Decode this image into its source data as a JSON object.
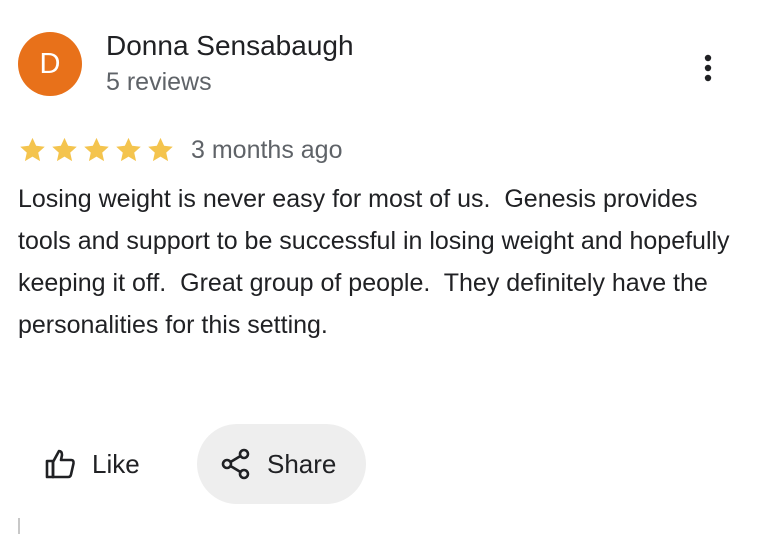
{
  "author": {
    "initial": "D",
    "name": "Donna Sensabaugh",
    "meta": "5 reviews",
    "avatar_color": "#e8711a"
  },
  "more_menu": {
    "icon": "more-vert-icon"
  },
  "review": {
    "rating": 5,
    "max_rating": 5,
    "star_color": "#f4c44e",
    "date": "3 months ago",
    "text": "Losing weight is never easy for most of us.  Genesis provides tools and support to be successful in losing weight and hopefully keeping it off.  Great group of people.  They definitely have the personalities for this setting."
  },
  "actions": {
    "like_label": "Like",
    "like_icon": "thumb-up-icon",
    "share_label": "Share",
    "share_icon": "share-icon"
  }
}
